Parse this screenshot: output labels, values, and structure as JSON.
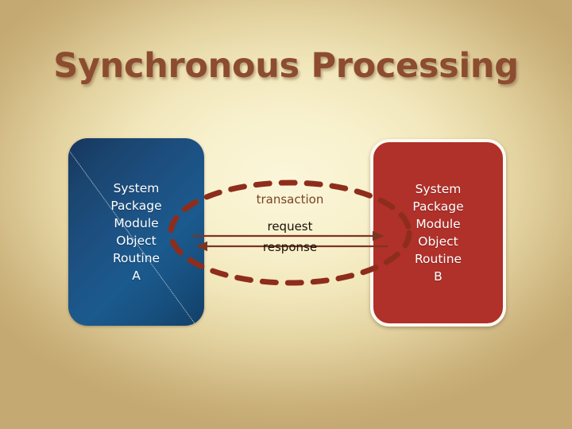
{
  "slide": {
    "title": "Synchronous Processing",
    "background": {
      "edge_color": "#c4a972",
      "center_color": "#fbf6da"
    },
    "title_color": "#8c4c2f"
  },
  "boxes": [
    {
      "id": "a",
      "side": "left",
      "fill_color": "#1b5a8e",
      "text_color": "#ffffff",
      "lines": [
        "System",
        "Package",
        "Module",
        "Object",
        "Routine",
        "A"
      ]
    },
    {
      "id": "b",
      "side": "right",
      "fill_color": "#b0302a",
      "border_color": "#fdfaf0",
      "text_color": "#ffffff",
      "lines": [
        "System",
        "Package",
        "Module",
        "Object",
        "Routine",
        "B"
      ]
    }
  ],
  "center": {
    "transaction_label": "transaction",
    "request_label": "request",
    "response_label": "response",
    "transaction_color": "#7a4326",
    "message_color": "#1a1208",
    "arrow_color": "#7b3524",
    "ellipse_color": "#8e2d1c",
    "request_direction": "left-to-right",
    "response_direction": "right-to-left"
  }
}
